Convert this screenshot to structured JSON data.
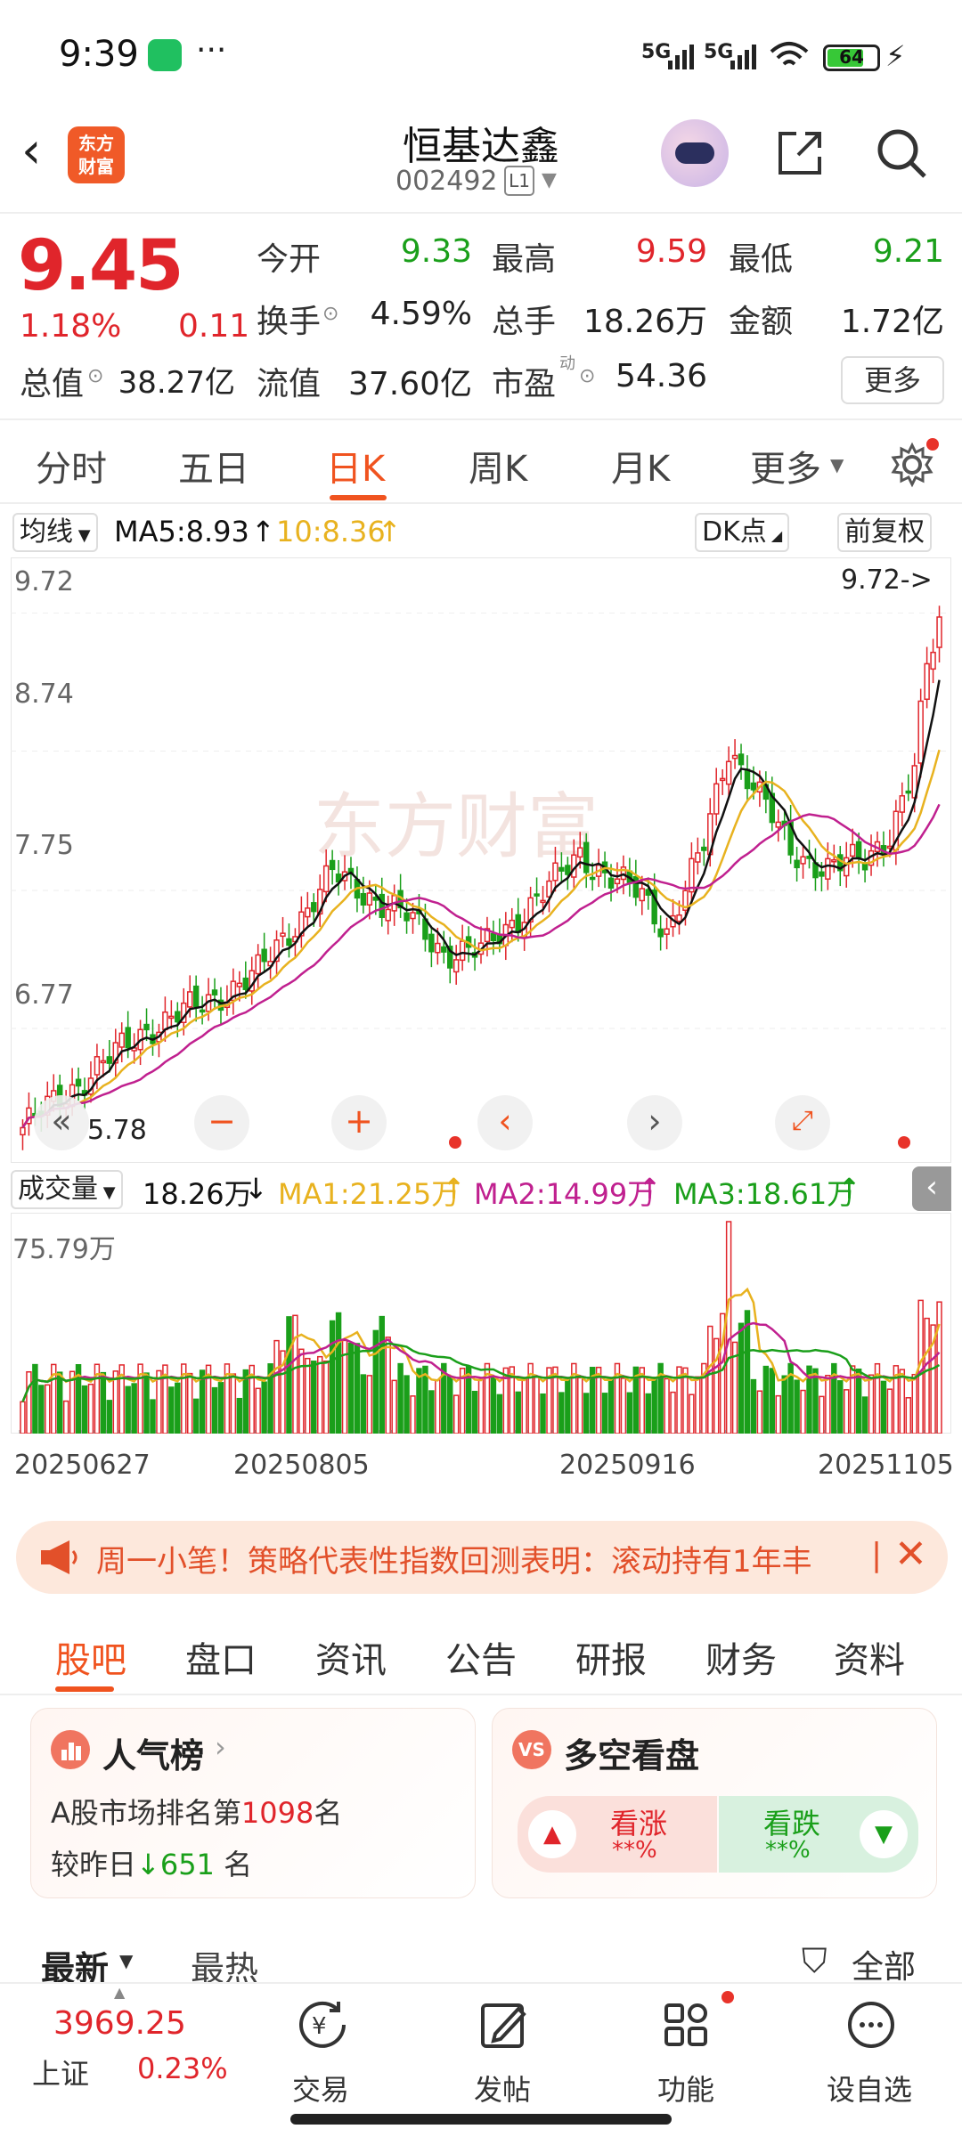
{
  "status": {
    "time": "9:39",
    "signal1": "5G",
    "signal2": "5G",
    "battery": "64"
  },
  "header": {
    "back": "‹",
    "app_logo": "东方\n财富",
    "name": "恒基达鑫",
    "code": "002492",
    "level": "L1"
  },
  "quote": {
    "price": "9.45",
    "pct": "1.18%",
    "change": "0.11",
    "open_label": "今开",
    "open": "9.33",
    "high_label": "最高",
    "high": "9.59",
    "low_label": "最低",
    "low": "9.21",
    "turnover_label": "换手",
    "turnover": "4.59%",
    "volume_label": "总手",
    "volume": "18.26万",
    "amount_label": "金额",
    "amount": "1.72亿",
    "mcap_label": "总值",
    "mcap": "38.27亿",
    "float_label": "流值",
    "float": "37.60亿",
    "pe_label": "市盈",
    "pe_sup": "动",
    "pe": "54.36",
    "more": "更多"
  },
  "periods": [
    "分时",
    "五日",
    "日K",
    "周K",
    "月K",
    "更多"
  ],
  "ma": {
    "selector": "均线",
    "ma5": "MA5:8.93",
    "ma10": "10:8.36",
    "dk": "DK点",
    "fq": "前复权"
  },
  "kchart": {
    "ylabels": [
      "9.72",
      "8.74",
      "7.75",
      "6.77"
    ],
    "max_tag": "9.72->",
    "min_tag": "5.78"
  },
  "volume": {
    "selector": "成交量",
    "current": "18.26万",
    "ma1": "MA1:21.25万",
    "ma2": "MA2:14.99万",
    "ma3": "MA3:18.61万",
    "max_label": "75.79万",
    "dates": [
      "20250627",
      "20250805",
      "20250916",
      "20251105"
    ]
  },
  "banner": {
    "text": "周一小笔！策略代表性指数回测表明：滚动持有1年丰"
  },
  "sections": [
    "股吧",
    "盘口",
    "资讯",
    "公告",
    "研报",
    "财务",
    "资料"
  ],
  "popularity": {
    "title": "人气榜",
    "line1_prefix": "A股市场排名第",
    "rank": "1098",
    "line1_suffix": "名",
    "line2_prefix": "较昨日",
    "delta": "651",
    "line2_suffix": "名"
  },
  "sentiment": {
    "title": "多空看盘",
    "up": "看涨",
    "down": "看跌",
    "up_val": "**%",
    "down_val": "**%"
  },
  "feed": {
    "latest": "最新",
    "hot": "最热",
    "filter": "全部"
  },
  "bottom": {
    "index_value": "3969.25",
    "index_name": "上证",
    "index_pct": "0.23%",
    "trade": "交易",
    "post": "发帖",
    "func": "功能",
    "watch": "设自选"
  },
  "colors": {
    "up": "#e0252b",
    "down": "#1a9f1a",
    "accent": "#f0531f",
    "ma5": "#111111",
    "ma10": "#e8b21f",
    "ma20": "#c0208f"
  }
}
